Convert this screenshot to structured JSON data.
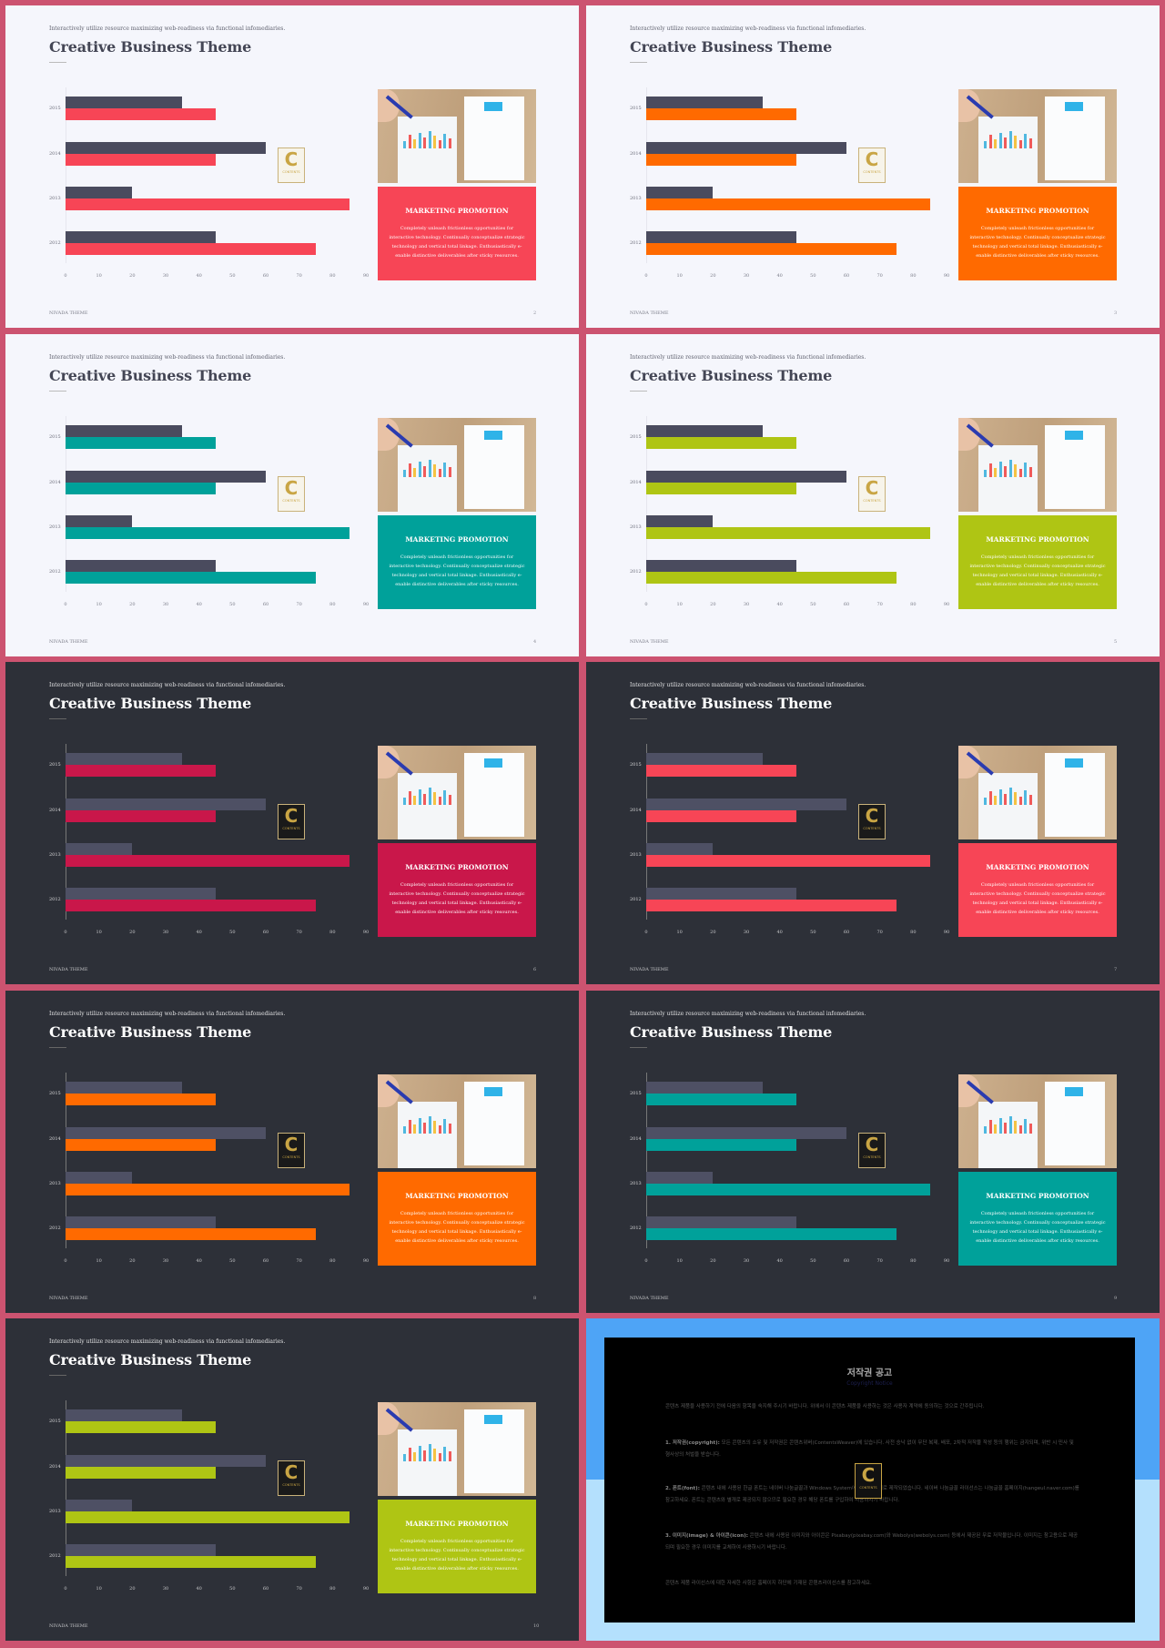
{
  "slide_text": {
    "subtitle": "Interactively utilize resource maximizing web-readiness via functional infomediaries.",
    "title": "Creative Business Theme",
    "box_heading": "MARKETING PROMOTION",
    "box_body": "Completely unleash frictionless opportunities for interactive technology. Continually conceptualize strategic technology and vertical total linkage. Enthusiastically e-enable distinctive deliverables after sticky resources.",
    "footer": "NIVADA THEME",
    "logo_text": "CONTENTS",
    "logo_letter": "C"
  },
  "slides": [
    {
      "theme": "light",
      "accent": "#f74556",
      "page": "2"
    },
    {
      "theme": "light",
      "accent": "#ff6a00",
      "page": "3"
    },
    {
      "theme": "light",
      "accent": "#00a19a",
      "page": "4"
    },
    {
      "theme": "light",
      "accent": "#afc514",
      "page": "5"
    },
    {
      "theme": "dark",
      "accent": "#c9174a",
      "page": "6"
    },
    {
      "theme": "dark",
      "accent": "#f74556",
      "page": "7"
    },
    {
      "theme": "dark",
      "accent": "#ff6a00",
      "page": "8"
    },
    {
      "theme": "dark",
      "accent": "#00a19a",
      "page": "9"
    },
    {
      "theme": "dark",
      "accent": "#afc514",
      "page": "10"
    }
  ],
  "colors": {
    "frame": "#cc5370",
    "light_bar": "#4a4b5e",
    "dark_bar": "#4e5064",
    "light_bg": "#f5f6fc",
    "dark_bg": "#2d3038"
  },
  "chart_data": {
    "type": "bar",
    "orientation": "horizontal",
    "categories": [
      "2015",
      "2014",
      "2013",
      "2012"
    ],
    "series": [
      {
        "values": [
          35,
          60,
          20,
          45
        ]
      },
      {
        "values": [
          45,
          45,
          85,
          75
        ]
      }
    ],
    "xlim": [
      0,
      90
    ],
    "xticks": [
      "0",
      "10",
      "20",
      "30",
      "40",
      "50",
      "60",
      "70",
      "80",
      "90"
    ],
    "grid": false
  },
  "copyright": {
    "title": "저작권 공고",
    "subtitle": "Copyright Notice",
    "intro": "콘텐츠 제품을 사용하기 전에 다음의 항목을 숙지해 주시기 바랍니다. 위에서 이 콘텐츠 제품을 사용하는 것은 사용자 계약에 동의하는 것으로 간주됩니다.",
    "items": [
      {
        "label": "1. 저작권(copyright):",
        "text": "모든 콘텐츠의 소유 및 저작권은 콘텐츠위버(ContentsWeaver)에 있습니다. 사전 승낙 없이 무단 복제, 배포, 2차적 저작물 작성 등의 행위는 금지되며, 위반 시 민사 및 형사상의 처벌을 받습니다."
      },
      {
        "label": "2. 폰트(font):",
        "text": "콘텐츠 내에 사용된 한글 폰트는 네이버 나눔글꼴과 Windows System에 포함된 서체로 제작되었습니다. 네이버 나눔글꼴 라이선스는 나눔글꼴 홈페이지(hangeul.naver.com)를 참고하세요. 폰트는 콘텐츠와 별개로 제공되지 않으므로 필요한 경우 해당 폰트를 구입하여 사용하시기 바랍니다."
      },
      {
        "label": "3. 이미지(image) & 아이콘(icon):",
        "text": "콘텐츠 내에 사용된 이미지와 아이콘은 Pixabay(pixabay.com)와 Webolys(webolys.com) 등에서 제공된 무료 저작물입니다. 이미지는 참고용으로 제공되며 필요한 경우 이미지를 교체하여 사용하시기 바랍니다."
      }
    ],
    "outro": "콘텐츠 제품 라이선스에 대한 자세한 사항은 홈페이지 하단에 기재된 콘텐츠라이선스를 참고하세요."
  }
}
